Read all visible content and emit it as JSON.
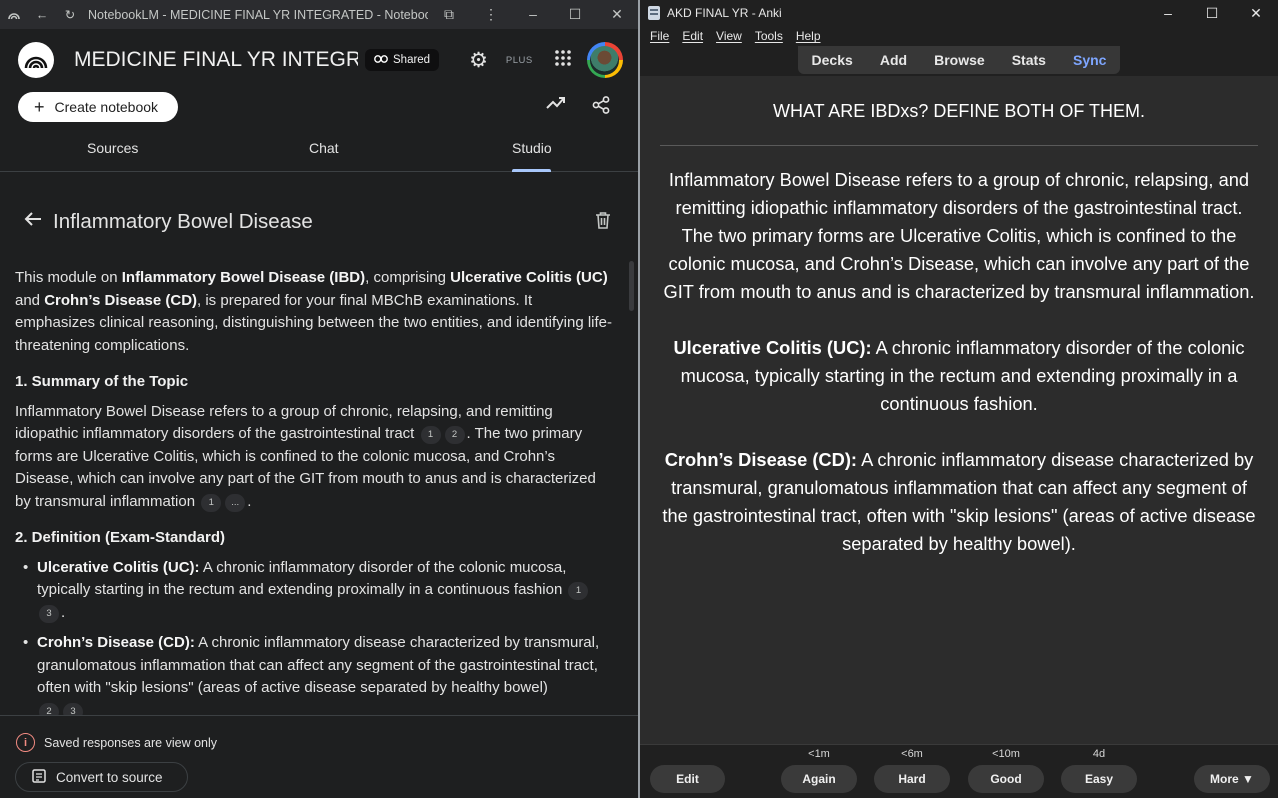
{
  "notebook": {
    "window_title": "NotebookLM - MEDICINE FINAL YR INTEGRATED - NotebookLM",
    "title": "MEDICINE FINAL YR INTEGRATED",
    "shared_label": "Shared",
    "plus_label": "PLUS",
    "create_label": "Create notebook",
    "tabs": [
      "Sources",
      "Chat",
      "Studio"
    ],
    "active_tab": "Studio",
    "panel_title": "Inflammatory Bowel Disease",
    "intro": {
      "t1": "This module on ",
      "b1": "Inflammatory Bowel Disease (IBD)",
      "t2": ", comprising ",
      "b2": "Ulcerative Colitis (UC)",
      "t3": " and ",
      "b3": "Crohn’s Disease (CD)",
      "t4": ", is prepared for your final MBChB examinations. It emphasizes clinical reasoning, distinguishing between the two entities, and identifying life-threatening complications."
    },
    "h1": "1. Summary of the Topic",
    "summary": {
      "t1": "Inflammatory Bowel Disease refers to a group of chronic, relapsing, and remitting idiopathic inflammatory disorders of the gastrointestinal tract",
      "c1": "1",
      "c2": "2",
      "t2": ". The two primary forms are Ulcerative Colitis, which is confined to the colonic mucosa, and Crohn’s Disease, which can involve any part of the GIT from mouth to anus and is characterized by transmural inflammation",
      "c3": "1",
      "c4": "...",
      "t3": "."
    },
    "h2": "2. Definition (Exam-Standard)",
    "def_uc": {
      "b": "Ulcerative Colitis (UC):",
      "t": " A chronic inflammatory disorder of the colonic mucosa, typically starting in the rectum and extending proximally in a continuous fashion",
      "c1": "1",
      "c2": "3",
      "end": "."
    },
    "def_cd": {
      "b": "Crohn’s Disease (CD):",
      "t": " A chronic inflammatory disease characterized by transmural, granulomatous inflammation that can affect any segment of the gastrointestinal tract, often with \"skip lesions\" (areas of active disease separated by healthy bowel)",
      "c1": "2",
      "c2": "3"
    },
    "saved_note": "Saved responses are view only",
    "convert_label": "Convert to source"
  },
  "anki": {
    "window_title": "AKD FINAL YR - Anki",
    "menu": [
      "File",
      "Edit",
      "View",
      "Tools",
      "Help"
    ],
    "toolbar": [
      "Decks",
      "Add",
      "Browse",
      "Stats",
      "Sync"
    ],
    "question": "WHAT ARE IBDxs?  DEFINE BOTH OF THEM.",
    "answer_p1": "Inflammatory Bowel Disease refers to a group of chronic, relapsing, and remitting idiopathic inflammatory disorders of the gastrointestinal tract. The two primary forms are Ulcerative Colitis, which is confined to the colonic mucosa, and Crohn’s Disease, which can involve any part of the GIT from mouth to anus and is characterized by transmural inflammation.",
    "uc_label": "Ulcerative Colitis (UC):",
    "uc_text": " A chronic inflammatory disorder of the colonic mucosa, typically starting in the rectum and extending proximally in a continuous fashion.",
    "cd_label": "Crohn’s Disease (CD):",
    "cd_text": " A chronic inflammatory disease characterized by transmural, granulomatous inflammation that can affect any segment of the gastrointestinal tract, often with \"skip lesions\" (areas of active disease separated by healthy bowel).",
    "edit_label": "Edit",
    "more_label": "More ▼",
    "answers": [
      {
        "label": "Again",
        "time": "<1m"
      },
      {
        "label": "Hard",
        "time": "<6m"
      },
      {
        "label": "Good",
        "time": "<10m"
      },
      {
        "label": "Easy",
        "time": "4d"
      }
    ]
  },
  "colors": {
    "notebook_bg": "#1e1f20",
    "anki_bg": "#2c2c2c",
    "tab_accent": "#a8c7fa",
    "sync_accent": "#7ea6ff",
    "info_accent": "#f28b82"
  }
}
